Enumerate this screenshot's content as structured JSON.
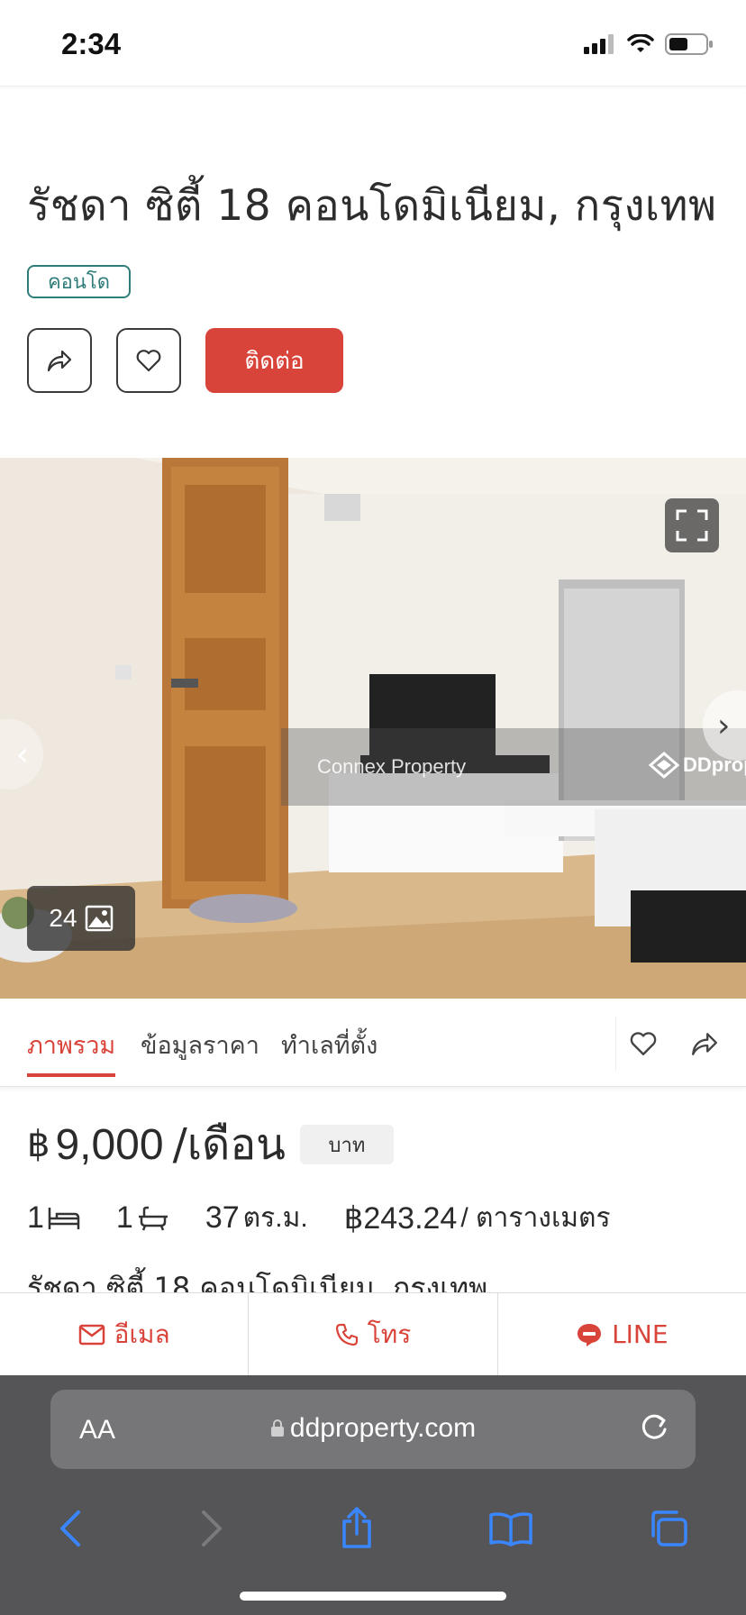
{
  "status_bar": {
    "time": "2:34"
  },
  "listing": {
    "title": "รัชดา ซิตี้ 18 คอนโดมิเนียม, กรุงเทพ",
    "type_badge": "คอนโด",
    "contact_label": "ติดต่อ"
  },
  "gallery": {
    "photo_count": "24",
    "watermark_text": "Connex Property",
    "watermark_logo": "DDprop"
  },
  "tabs": [
    {
      "label": "ภาพรวม",
      "active": true
    },
    {
      "label": "ข้อมูลราคา",
      "active": false
    },
    {
      "label": "ทำเลที่ตั้ง",
      "active": false
    }
  ],
  "price": {
    "currency_symbol": "฿",
    "value": "9,000",
    "unit": "/เดือน",
    "currency_chip": "บาท"
  },
  "specs": {
    "bedrooms": "1",
    "bathrooms": "1",
    "area_value": "37",
    "area_unit": "ตร.ม.",
    "price_per_sqm": "฿243.24",
    "price_per_sqm_unit": "/ ตารางเมตร"
  },
  "subtitle": "รัชดา ซิตี้ 18 คอนโดมิเนียม, กรุงเทพ",
  "contact_bar": {
    "email": "อีเมล",
    "call": "โทร",
    "line": "LINE"
  },
  "browser": {
    "text_size_label": "AA",
    "url": "ddproperty.com"
  },
  "colors": {
    "accent": "#d9443a",
    "badge": "#2f7d7a",
    "browser_bg": "#555557",
    "link_blue": "#3a86ff"
  }
}
